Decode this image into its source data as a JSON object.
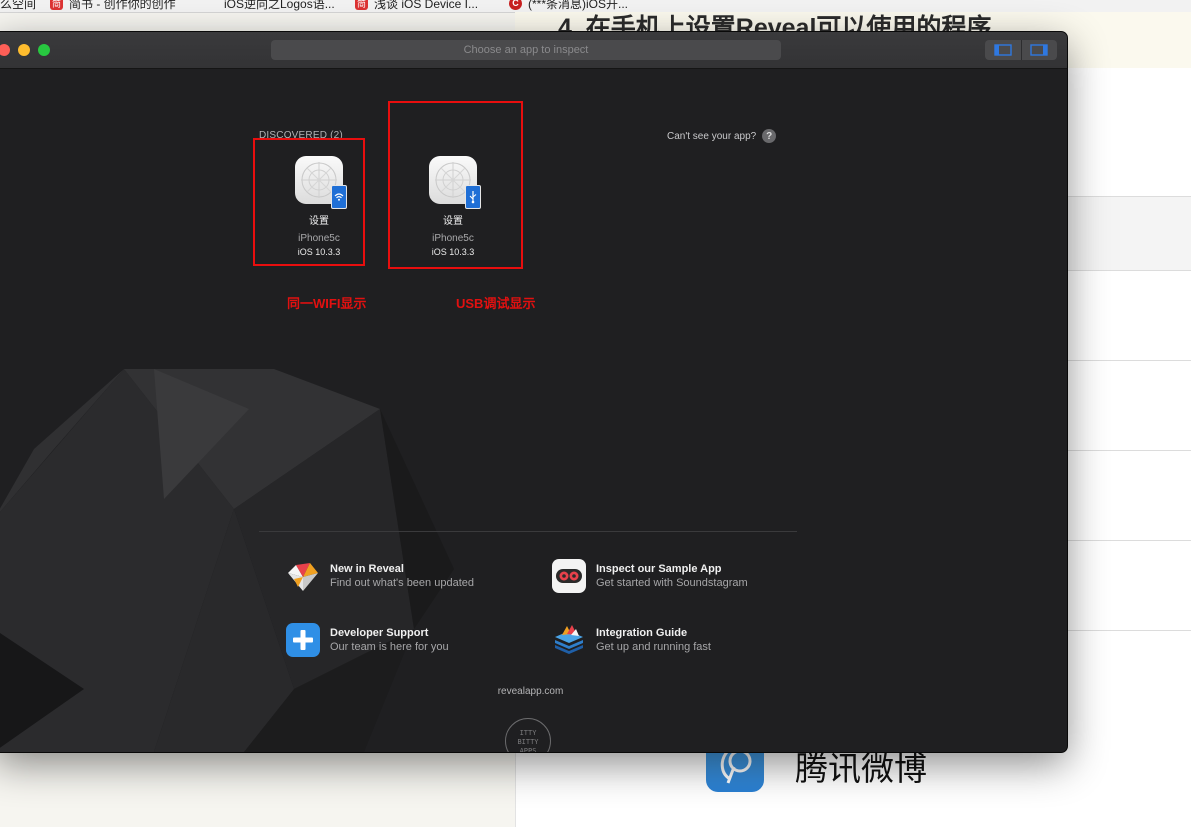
{
  "browser": {
    "bookmarks": [
      {
        "label": "么空间",
        "badge": ""
      },
      {
        "label": "简书 - 创作你的创作",
        "badge": "简"
      },
      {
        "label": "iOS逆向之Logos语...",
        "badge": ""
      },
      {
        "label": "浅谈 iOS Device I...",
        "badge": "简"
      },
      {
        "label": "(***条消息)iOS开...",
        "badge": "C"
      }
    ]
  },
  "background_doc": {
    "heading": "4. 在手机上设置Reveal可以使用的程序",
    "weibo_label": "腾讯微博"
  },
  "window": {
    "app_picker_placeholder": "Choose an app to inspect",
    "discovered_label": "DISCOVERED (2)",
    "cant_see_label": "Can't see your app?",
    "help_symbol": "?",
    "devices": [
      {
        "app": "设置",
        "device": "iPhone5c",
        "os": "iOS 10.3.3",
        "connection": "wifi-icon"
      },
      {
        "app": "设置",
        "device": "iPhone5c",
        "os": "iOS 10.3.3",
        "connection": "usb-icon"
      }
    ],
    "annotations": {
      "wifi": "同一WIFI显示",
      "usb": "USB调试显示",
      "color": "#e21010"
    },
    "links": [
      {
        "title": "New in Reveal",
        "subtitle": "Find out what's been updated",
        "icon": "reveal-logo-icon"
      },
      {
        "title": "Inspect our Sample App",
        "subtitle": "Get started with Soundstagram",
        "icon": "soundstagram-icon"
      },
      {
        "title": "Developer Support",
        "subtitle": "Our team is here for you",
        "icon": "support-plus-icon"
      },
      {
        "title": "Integration Guide",
        "subtitle": "Get up and running fast",
        "icon": "integration-guide-icon"
      }
    ],
    "footer_url": "revealapp.com",
    "footer_logo_text": "ITTY BITTY APPS"
  }
}
